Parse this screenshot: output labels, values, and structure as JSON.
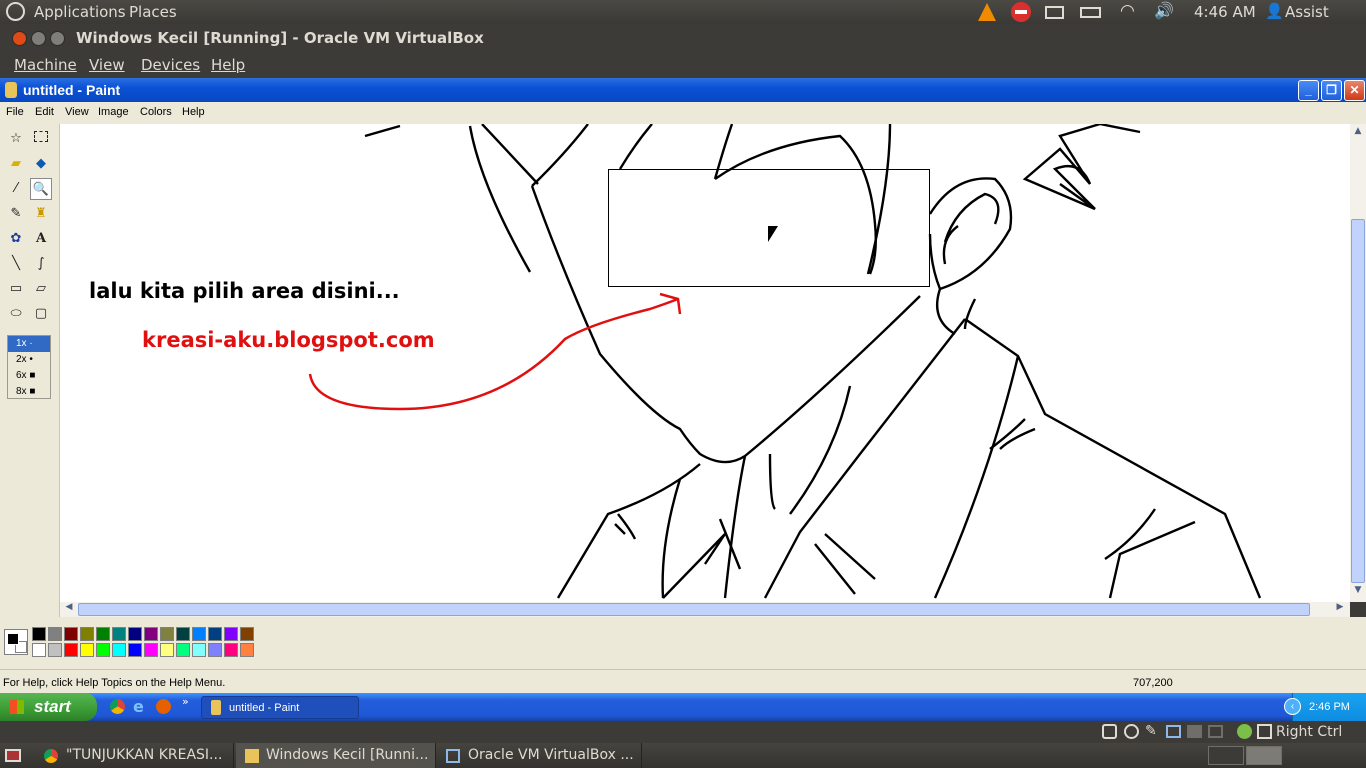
{
  "ubuntu_panel": {
    "applications": "Applications",
    "places": "Places",
    "time": "4:46 AM",
    "user": "Assist"
  },
  "vbox": {
    "window_title": "Windows Kecil [Running] - Oracle VM VirtualBox",
    "menu": [
      "Machine",
      "View",
      "Devices",
      "Help"
    ],
    "host_key": "Right Ctrl"
  },
  "paint": {
    "title": "untitled - Paint",
    "menu": [
      "File",
      "Edit",
      "View",
      "Image",
      "Colors",
      "Help"
    ],
    "zoom_options": [
      "1x",
      "2x",
      "6x",
      "8x"
    ],
    "canvas_text": {
      "caption": "lalu kita pilih area disini...",
      "watermark": "kreasi-aku.blogspot.com"
    },
    "status_help": "For Help, click Help Topics on the Help Menu.",
    "status_coords": "707,200",
    "palette_top": [
      "#000000",
      "#808080",
      "#800000",
      "#808000",
      "#008000",
      "#008080",
      "#000080",
      "#800080",
      "#808040",
      "#004040",
      "#0080ff",
      "#004080",
      "#8000ff",
      "#804000"
    ],
    "palette_bottom": [
      "#ffffff",
      "#c0c0c0",
      "#ff0000",
      "#ffff00",
      "#00ff00",
      "#00ffff",
      "#0000ff",
      "#ff00ff",
      "#ffff80",
      "#00ff80",
      "#80ffff",
      "#8080ff",
      "#ff0080",
      "#ff8040"
    ]
  },
  "xp_taskbar": {
    "start": "start",
    "task": "untitled - Paint",
    "time": "2:46 PM"
  },
  "ubuntu_bottom": {
    "tasks": [
      "\"TUNJUKKAN KREASI...",
      "Windows Kecil [Runni...",
      "Oracle VM VirtualBox ..."
    ]
  }
}
